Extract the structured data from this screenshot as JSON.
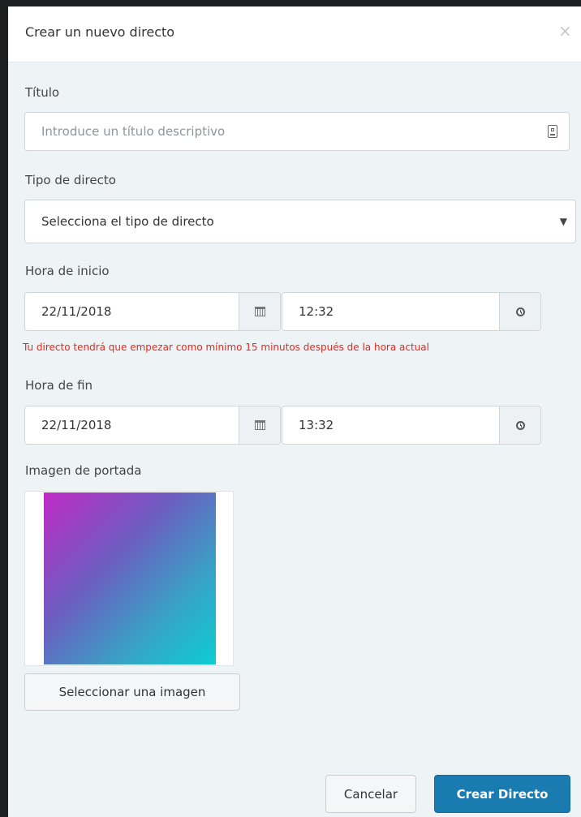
{
  "modal": {
    "title": "Crear un nuevo directo",
    "close_symbol": "×"
  },
  "form": {
    "title_label": "Título",
    "title_placeholder": "Introduce un título descriptivo",
    "type_label": "Tipo de directo",
    "type_selected": "Selecciona el tipo de directo",
    "start_label": "Hora de inicio",
    "start_date": "22/11/2018",
    "start_time": "12:32",
    "start_error": "Tu directo tendrá que empezar como mínimo 15 minutos después de la hora actual",
    "end_label": "Hora de fin",
    "end_date": "22/11/2018",
    "end_time": "13:32",
    "cover_label": "Imagen de portada",
    "select_image_label": "Seleccionar una imagen"
  },
  "footer": {
    "cancel_label": "Cancelar",
    "create_label": "Crear Directo"
  },
  "icons": {
    "title_field_icon": "contact-card-icon",
    "date_icon": "calendar-icon",
    "time_icon": "clock-icon",
    "select_caret": "▼"
  },
  "colors": {
    "primary": "#1a7bb0",
    "error": "#e8261a",
    "modal_background": "#eef4f6"
  }
}
